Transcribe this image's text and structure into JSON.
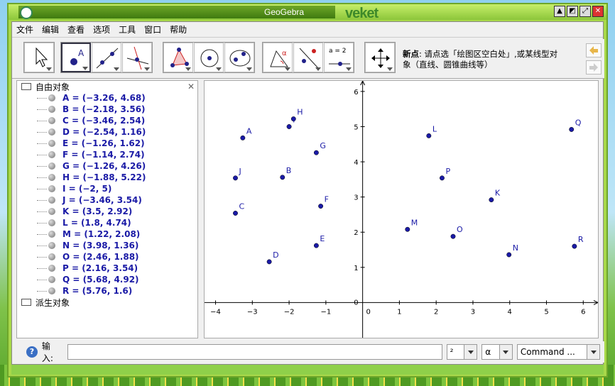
{
  "window": {
    "title": "GeoGebra",
    "brand": "veket"
  },
  "menu": [
    "文件",
    "编辑",
    "查看",
    "选项",
    "工具",
    "窗口",
    "帮助"
  ],
  "toolbar": {
    "tooltip_title": "新点",
    "tooltip_body": ": 请点选「绘图区空白处」,或某线型对象（直线、圆锥曲线等）",
    "slider_label": "a = 2"
  },
  "algebra": {
    "free_objects_label": "自由对象",
    "dependent_objects_label": "派生对象",
    "points": [
      {
        "name": "A",
        "x": -3.26,
        "y": 4.68
      },
      {
        "name": "B",
        "x": -2.18,
        "y": 3.56
      },
      {
        "name": "C",
        "x": -3.46,
        "y": 2.54
      },
      {
        "name": "D",
        "x": -2.54,
        "y": 1.16
      },
      {
        "name": "E",
        "x": -1.26,
        "y": 1.62
      },
      {
        "name": "F",
        "x": -1.14,
        "y": 2.74
      },
      {
        "name": "G",
        "x": -1.26,
        "y": 4.26
      },
      {
        "name": "H",
        "x": -1.88,
        "y": 5.22
      },
      {
        "name": "I",
        "x": -2,
        "y": 5
      },
      {
        "name": "J",
        "x": -3.46,
        "y": 3.54
      },
      {
        "name": "K",
        "x": 3.5,
        "y": 2.92
      },
      {
        "name": "L",
        "x": 1.8,
        "y": 4.74
      },
      {
        "name": "M",
        "x": 1.22,
        "y": 2.08
      },
      {
        "name": "N",
        "x": 3.98,
        "y": 1.36
      },
      {
        "name": "O",
        "x": 2.46,
        "y": 1.88
      },
      {
        "name": "P",
        "x": 2.16,
        "y": 3.54
      },
      {
        "name": "Q",
        "x": 5.68,
        "y": 4.92
      },
      {
        "name": "R",
        "x": 5.76,
        "y": 1.6
      }
    ]
  },
  "graphics": {
    "x_ticks": [
      "−4",
      "−3",
      "−2",
      "−1",
      "0",
      "1",
      "2",
      "3",
      "4",
      "5",
      "6"
    ],
    "y_ticks": [
      "1",
      "2",
      "3",
      "4",
      "5",
      "6"
    ],
    "x_range": [
      -4.3,
      6.4
    ],
    "y_range": [
      -1,
      6.3
    ]
  },
  "input": {
    "label": "输入:",
    "value": "",
    "exponent_combo": "²",
    "greek_combo": "α",
    "command_combo": "Command ..."
  }
}
